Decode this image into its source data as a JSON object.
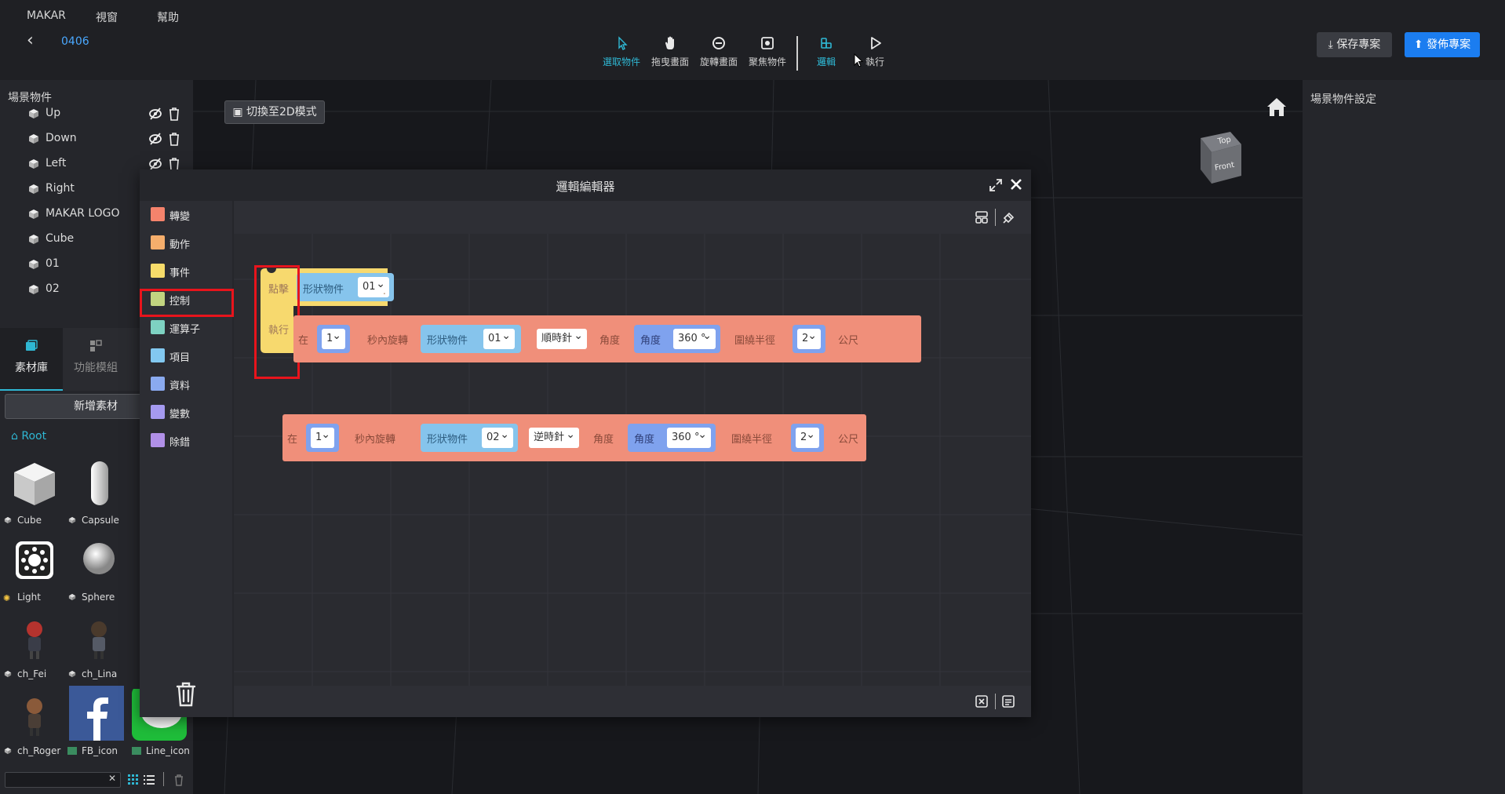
{
  "menu": [
    "MAKAR",
    "視窗",
    "幫助"
  ],
  "project": {
    "name": "0406"
  },
  "tools": [
    {
      "label": "選取物件",
      "icon": "cursor-icon",
      "active": true
    },
    {
      "label": "拖曳畫面",
      "icon": "hand-icon",
      "active": false
    },
    {
      "label": "旋轉畫面",
      "icon": "rotate-view-icon",
      "active": false
    },
    {
      "label": "聚焦物件",
      "icon": "focus-icon",
      "active": false
    },
    {
      "label": "邏輯",
      "icon": "logic-icon",
      "active": true
    },
    {
      "label": "執行",
      "icon": "play-icon",
      "active": false
    }
  ],
  "actions": {
    "save": "保存專案",
    "publish": "發佈專案"
  },
  "viewport": {
    "mode_button": "切換至2D模式",
    "cube_top": "Top",
    "cube_front": "Front"
  },
  "scene": {
    "title": "場景物件",
    "items": [
      "Up",
      "Down",
      "Left",
      "Right",
      "MAKAR LOGO",
      "Cube",
      "01",
      "02"
    ]
  },
  "library": {
    "tabs": [
      "素材庫",
      "功能模組"
    ],
    "add_button": "新增素材",
    "root": "Root",
    "assets": [
      "Cube",
      "Capsule",
      "Light",
      "Sphere",
      "ch_Fei",
      "ch_Lina",
      "ch_Roger",
      "FB_icon",
      "Line_icon"
    ]
  },
  "properties": {
    "title": "場景物件設定"
  },
  "editor": {
    "title": "邏輯編輯器",
    "categories": [
      {
        "label": "轉變",
        "color": "#f5836c"
      },
      {
        "label": "動作",
        "color": "#f5ae6c"
      },
      {
        "label": "事件",
        "color": "#f7dc6a"
      },
      {
        "label": "控制",
        "color": "#c2d480"
      },
      {
        "label": "運算子",
        "color": "#7ed2c2"
      },
      {
        "label": "項目",
        "color": "#82c8f0"
      },
      {
        "label": "資料",
        "color": "#8aaaf0"
      },
      {
        "label": "變數",
        "color": "#a59af0"
      },
      {
        "label": "除錯",
        "color": "#b190e8"
      }
    ],
    "event_block": {
      "click_label": "點擊",
      "do_label": "執行",
      "object_label": "形狀物件",
      "object_value": "01"
    },
    "rotate_block_1": {
      "in_label": "在",
      "seconds": "1",
      "seconds_label": "秒內旋轉",
      "object_label": "形狀物件",
      "object_value": "01",
      "direction": "順時針",
      "angle_label": "角度",
      "angle_inner_label": "角度",
      "angle_value": "360 °",
      "radius_label": "圍繞半徑",
      "radius_value": "2",
      "unit": "公尺"
    },
    "rotate_block_2": {
      "in_label": "在",
      "seconds": "1",
      "seconds_label": "秒內旋轉",
      "object_label": "形狀物件",
      "object_value": "02",
      "direction": "逆時針",
      "angle_label": "角度",
      "angle_inner_label": "角度",
      "angle_value": "360 °",
      "radius_label": "圍繞半徑",
      "radius_value": "2",
      "unit": "公尺"
    }
  }
}
